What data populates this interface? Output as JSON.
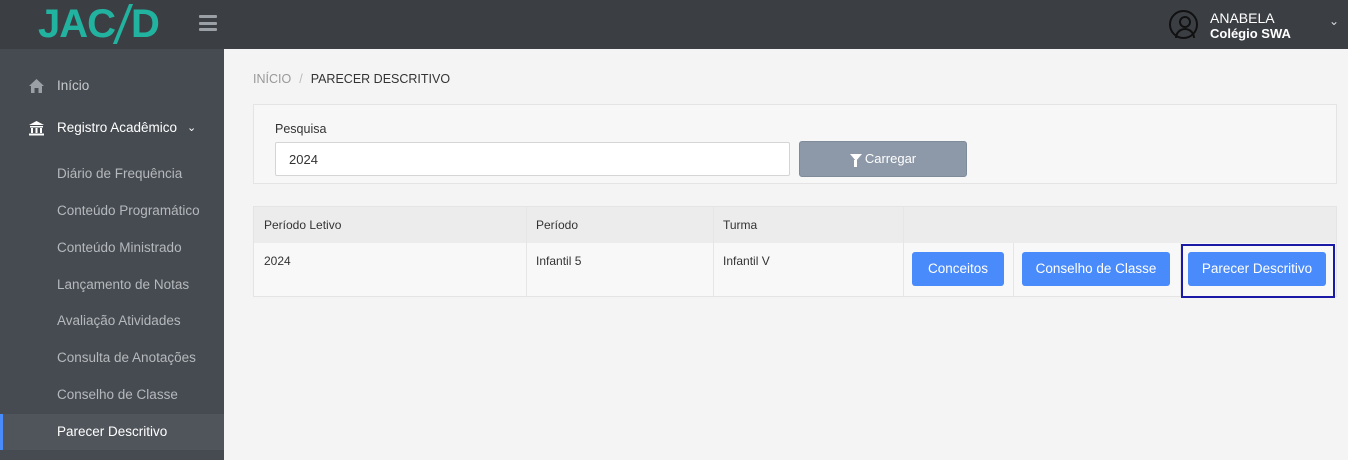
{
  "app": {
    "logo_text_1": "JAC",
    "logo_text_2": "D"
  },
  "header": {
    "user_name": "ANABELA",
    "user_org": "Colégio SWA",
    "caret": "⌄"
  },
  "sidebar": {
    "items": [
      {
        "label": "Início",
        "icon": "home-icon"
      },
      {
        "label": "Registro Acadêmico",
        "icon": "bank-icon",
        "chevron": "⌄"
      },
      {
        "label": "Diário de Frequência"
      },
      {
        "label": "Conteúdo Programático"
      },
      {
        "label": "Conteúdo Ministrado"
      },
      {
        "label": "Lançamento de Notas"
      },
      {
        "label": "Avaliação Atividades"
      },
      {
        "label": "Consulta de Anotações"
      },
      {
        "label": "Conselho de Classe"
      },
      {
        "label": "Parecer Descritivo"
      }
    ]
  },
  "breadcrumb": {
    "root": "INÍCIO",
    "separator": "/",
    "current": "PARECER DESCRITIVO"
  },
  "filter": {
    "label": "Pesquisa",
    "value": "2024",
    "button_label": "Carregar"
  },
  "table": {
    "headers": [
      "Período Letivo",
      "Período",
      "Turma"
    ],
    "rows": [
      {
        "periodo_letivo": "2024",
        "periodo": "Infantil 5",
        "turma": "Infantil V"
      }
    ],
    "actions": [
      "Conceitos",
      "Conselho de Classe",
      "Parecer Descritivo"
    ]
  },
  "colors": {
    "accent": "#4a8bfc",
    "brand": "#22b3a0",
    "topbar": "#3b3f44",
    "sidebar": "#464b51",
    "highlight": "#1a1aa6"
  }
}
